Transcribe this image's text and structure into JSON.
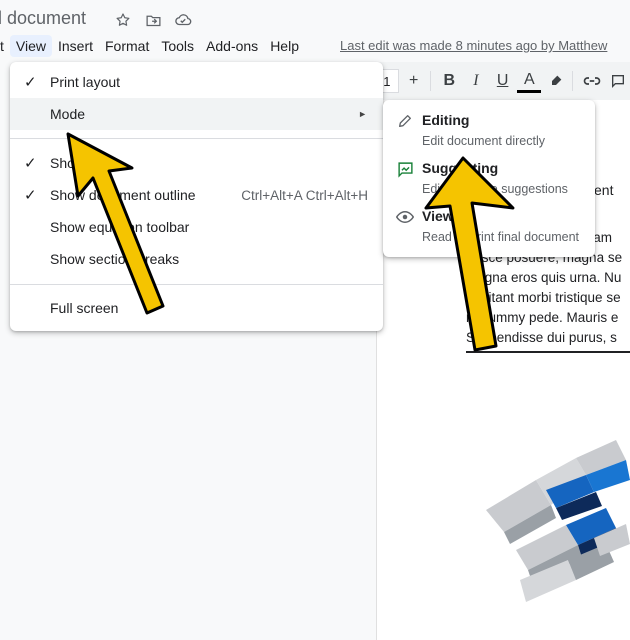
{
  "header": {
    "doc_title": "d document",
    "icons": [
      "star-icon",
      "folder-move-icon",
      "cloud-status-icon"
    ],
    "menus": [
      "t",
      "View",
      "Insert",
      "Format",
      "Tools",
      "Add-ons",
      "Help"
    ],
    "last_edit": "Last edit was made 8 minutes ago by Matthew"
  },
  "toolbar": {
    "font_size": "1",
    "plus": "+",
    "bold": "B",
    "italic": "I",
    "underline": "U",
    "text_color": "A",
    "icons": [
      "highlight-icon",
      "link-icon",
      "comment-icon"
    ]
  },
  "view_menu": {
    "items": [
      {
        "label": "Print layout",
        "checked": true,
        "check": "✓"
      },
      {
        "label": "Mode",
        "arrow": "►"
      },
      {
        "label": "Show ruler",
        "checked": true,
        "check": "✓",
        "visible_text": "Sho"
      },
      {
        "label": "Show document outline",
        "checked": true,
        "check": "✓",
        "shortcut": "Ctrl+Alt+A Ctrl+Alt+H"
      },
      {
        "label": "Show equation toolbar"
      },
      {
        "label": "Show section breaks"
      },
      {
        "label": "Full screen"
      }
    ]
  },
  "mode_menu": {
    "items": [
      {
        "title": "Editing",
        "desc": "Edit document directly",
        "icon": "pencil-icon"
      },
      {
        "title": "Suggesting",
        "desc": "Edits become suggestions",
        "icon": "suggest-icon"
      },
      {
        "title": "Viewing",
        "desc": "Read or print final document",
        "icon": "eye-icon"
      }
    ]
  },
  "document": {
    "heading_fragment": "ent",
    "lines": [
      "sit am",
      "Fusce posuere, magna se",
      "magna eros quis urna. Nu",
      "habitant morbi tristique se",
      "nonummy pede. Mauris e",
      "Suspendisse dui purus, s"
    ]
  },
  "colors": {
    "accent_yellow": "#f5c400",
    "suggest_green": "#188038",
    "menu_hover": "#f1f3f4"
  }
}
